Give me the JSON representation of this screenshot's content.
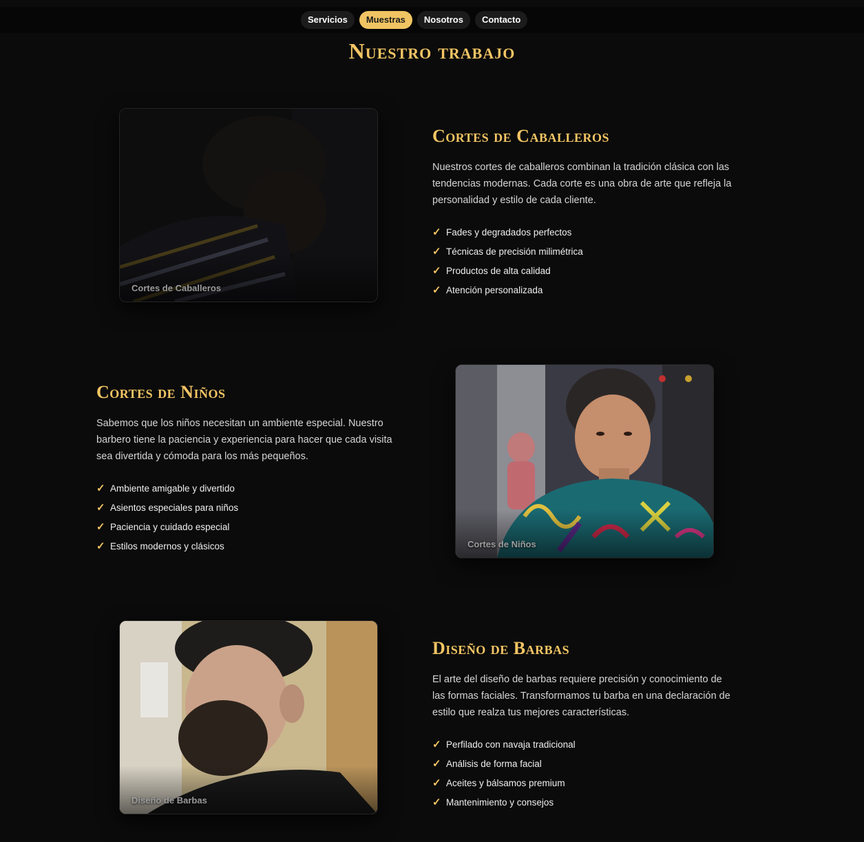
{
  "nav": {
    "items": [
      {
        "label": "Servicios",
        "active": false
      },
      {
        "label": "Muestras",
        "active": true
      },
      {
        "label": "Nosotros",
        "active": false
      },
      {
        "label": "Contacto",
        "active": false
      }
    ]
  },
  "page": {
    "title": "Nuestro trabajo"
  },
  "sections": [
    {
      "image_caption": "Cortes de Caballeros",
      "heading": "Cortes de Caballeros",
      "description": "Nuestros cortes de caballeros combinan la tradición clásica con las tendencias modernas. Cada corte es una obra de arte que refleja la personalidad y estilo de cada cliente.",
      "features": [
        "Fades y degradados perfectos",
        "Técnicas de precisión milimétrica",
        "Productos de alta calidad",
        "Atención personalizada"
      ]
    },
    {
      "image_caption": "Cortes de Niños",
      "heading": "Cortes de Niños",
      "description": "Sabemos que los niños necesitan un ambiente especial. Nuestro barbero tiene la paciencia y experiencia para hacer que cada visita sea divertida y cómoda para los más pequeños.",
      "features": [
        "Ambiente amigable y divertido",
        "Asientos especiales para niños",
        "Paciencia y cuidado especial",
        "Estilos modernos y clásicos"
      ]
    },
    {
      "image_caption": "Diseño de Barbas",
      "heading": "Diseño de Barbas",
      "description": "El arte del diseño de barbas requiere precisión y conocimiento de las formas faciales. Transformamos tu barba en una declaración de estilo que realza tus mejores características.",
      "features": [
        "Perfilado con navaja tradicional",
        "Análisis de forma facial",
        "Aceites y bálsamos premium",
        "Mantenimiento y consejos"
      ]
    }
  ],
  "check_glyph": "✓",
  "colors": {
    "accent": "#f3c564",
    "background": "#0b0b0b",
    "nav_pill": "#1b1b1b"
  }
}
